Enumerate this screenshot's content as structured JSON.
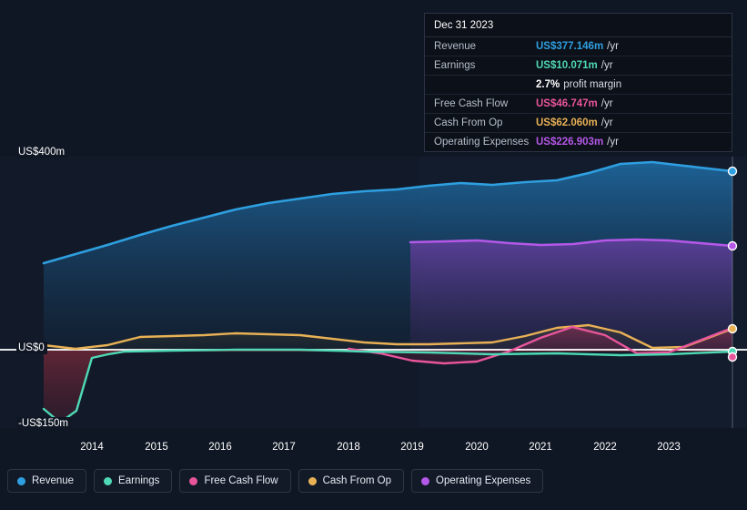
{
  "tooltip": {
    "date": "Dec 31 2023",
    "rows": [
      {
        "name": "Revenue",
        "value": "US$377.146m",
        "unit": "/yr",
        "color": "#2e9fe0"
      },
      {
        "name": "Earnings",
        "value": "US$10.071m",
        "unit": "/yr",
        "color": "#4fd9b5"
      },
      {
        "name": "",
        "value": "2.7%",
        "unit": "profit margin",
        "color": "#ffffff"
      },
      {
        "name": "Free Cash Flow",
        "value": "US$46.747m",
        "unit": "/yr",
        "color": "#e8559b"
      },
      {
        "name": "Cash From Op",
        "value": "US$62.060m",
        "unit": "/yr",
        "color": "#e8b155"
      },
      {
        "name": "Operating Expenses",
        "value": "US$226.903m",
        "unit": "/yr",
        "color": "#b558e8"
      }
    ]
  },
  "axis": {
    "y_top": "US$400m",
    "y_zero": "US$0",
    "y_bottom": "-US$150m"
  },
  "legend": [
    {
      "label": "Revenue",
      "color": "#2e9fe0"
    },
    {
      "label": "Earnings",
      "color": "#4fd9b5"
    },
    {
      "label": "Free Cash Flow",
      "color": "#e8559b"
    },
    {
      "label": "Cash From Op",
      "color": "#e8b155"
    },
    {
      "label": "Operating Expenses",
      "color": "#b558e8"
    }
  ],
  "chart_data": {
    "type": "area",
    "title": "",
    "xlabel": "",
    "ylabel": "",
    "ylim": [
      -150,
      400
    ],
    "y_ticks": [
      400,
      0,
      -150
    ],
    "y_tick_labels": [
      "US$400m",
      "US$0",
      "-US$150m"
    ],
    "x_ticks": [
      "2014",
      "2015",
      "2016",
      "2017",
      "2018",
      "2019",
      "2020",
      "2021",
      "2022",
      "2023"
    ],
    "x_tick_positions": [
      101,
      172,
      242,
      312,
      383,
      453,
      524,
      594,
      665,
      735
    ],
    "grid": false,
    "legend_position": "bottom-left",
    "currency": "US$ millions",
    "series": [
      {
        "name": "Revenue",
        "color": "#2e9fe0",
        "x": [
          2013.25,
          2013.75,
          2014.25,
          2014.75,
          2015.25,
          2015.75,
          2016.25,
          2016.75,
          2017.25,
          2017.75,
          2018.25,
          2018.75,
          2019.25,
          2019.75,
          2020.25,
          2020.75,
          2021.25,
          2021.75,
          2022.25,
          2022.75,
          2023.25,
          2023.95
        ],
        "values": [
          140,
          157,
          176,
          196,
          214,
          232,
          248,
          262,
          272,
          282,
          288,
          292,
          300,
          306,
          303,
          308,
          312,
          327,
          345,
          378,
          388,
          377
        ]
      },
      {
        "name": "Earnings",
        "color": "#4fd9b5",
        "x": [
          2013.25,
          2013.75,
          2014.25,
          2014.75,
          2015.25,
          2015.75,
          2016.25,
          2016.75,
          2017.25,
          2017.75,
          2018.25,
          2018.75,
          2019.25,
          2019.75,
          2020.25,
          2020.75,
          2021.25,
          2021.75,
          2022.25,
          2022.75,
          2023.25,
          2023.95
        ],
        "values": [
          -120,
          -148,
          -60,
          1,
          5,
          10,
          12,
          13,
          11,
          9,
          6,
          4,
          3,
          2,
          1,
          0,
          2,
          3,
          2,
          0,
          4,
          10
        ]
      },
      {
        "name": "Free Cash Flow",
        "color": "#e8559b",
        "x": [
          2018.0,
          2018.5,
          2019.0,
          2019.5,
          2020.0,
          2020.5,
          2021.0,
          2021.5,
          2022.0,
          2022.5,
          2023.0,
          2023.95
        ],
        "values": [
          2,
          -8,
          -22,
          -28,
          -24,
          -5,
          22,
          45,
          30,
          -8,
          -6,
          46
        ]
      },
      {
        "name": "Cash From Op",
        "color": "#e8b155",
        "x": [
          2013.25,
          2013.75,
          2014.25,
          2014.75,
          2015.25,
          2015.75,
          2016.25,
          2016.75,
          2017.25,
          2017.75,
          2018.25,
          2018.75,
          2019.25,
          2019.75,
          2020.25,
          2020.75,
          2021.25,
          2021.75,
          2022.25,
          2022.75,
          2023.25,
          2023.95
        ],
        "values": [
          10,
          2,
          10,
          26,
          27,
          29,
          32,
          30,
          28,
          22,
          16,
          13,
          13,
          14,
          16,
          30,
          44,
          50,
          35,
          5,
          7,
          62
        ]
      },
      {
        "name": "Operating Expenses",
        "color": "#b558e8",
        "x": [
          2018.95,
          2019.5,
          2020.0,
          2020.5,
          2021.0,
          2021.5,
          2022.0,
          2022.5,
          2023.0,
          2023.95
        ],
        "values": [
          228,
          230,
          231,
          226,
          222,
          223,
          232,
          234,
          232,
          227
        ]
      }
    ]
  }
}
